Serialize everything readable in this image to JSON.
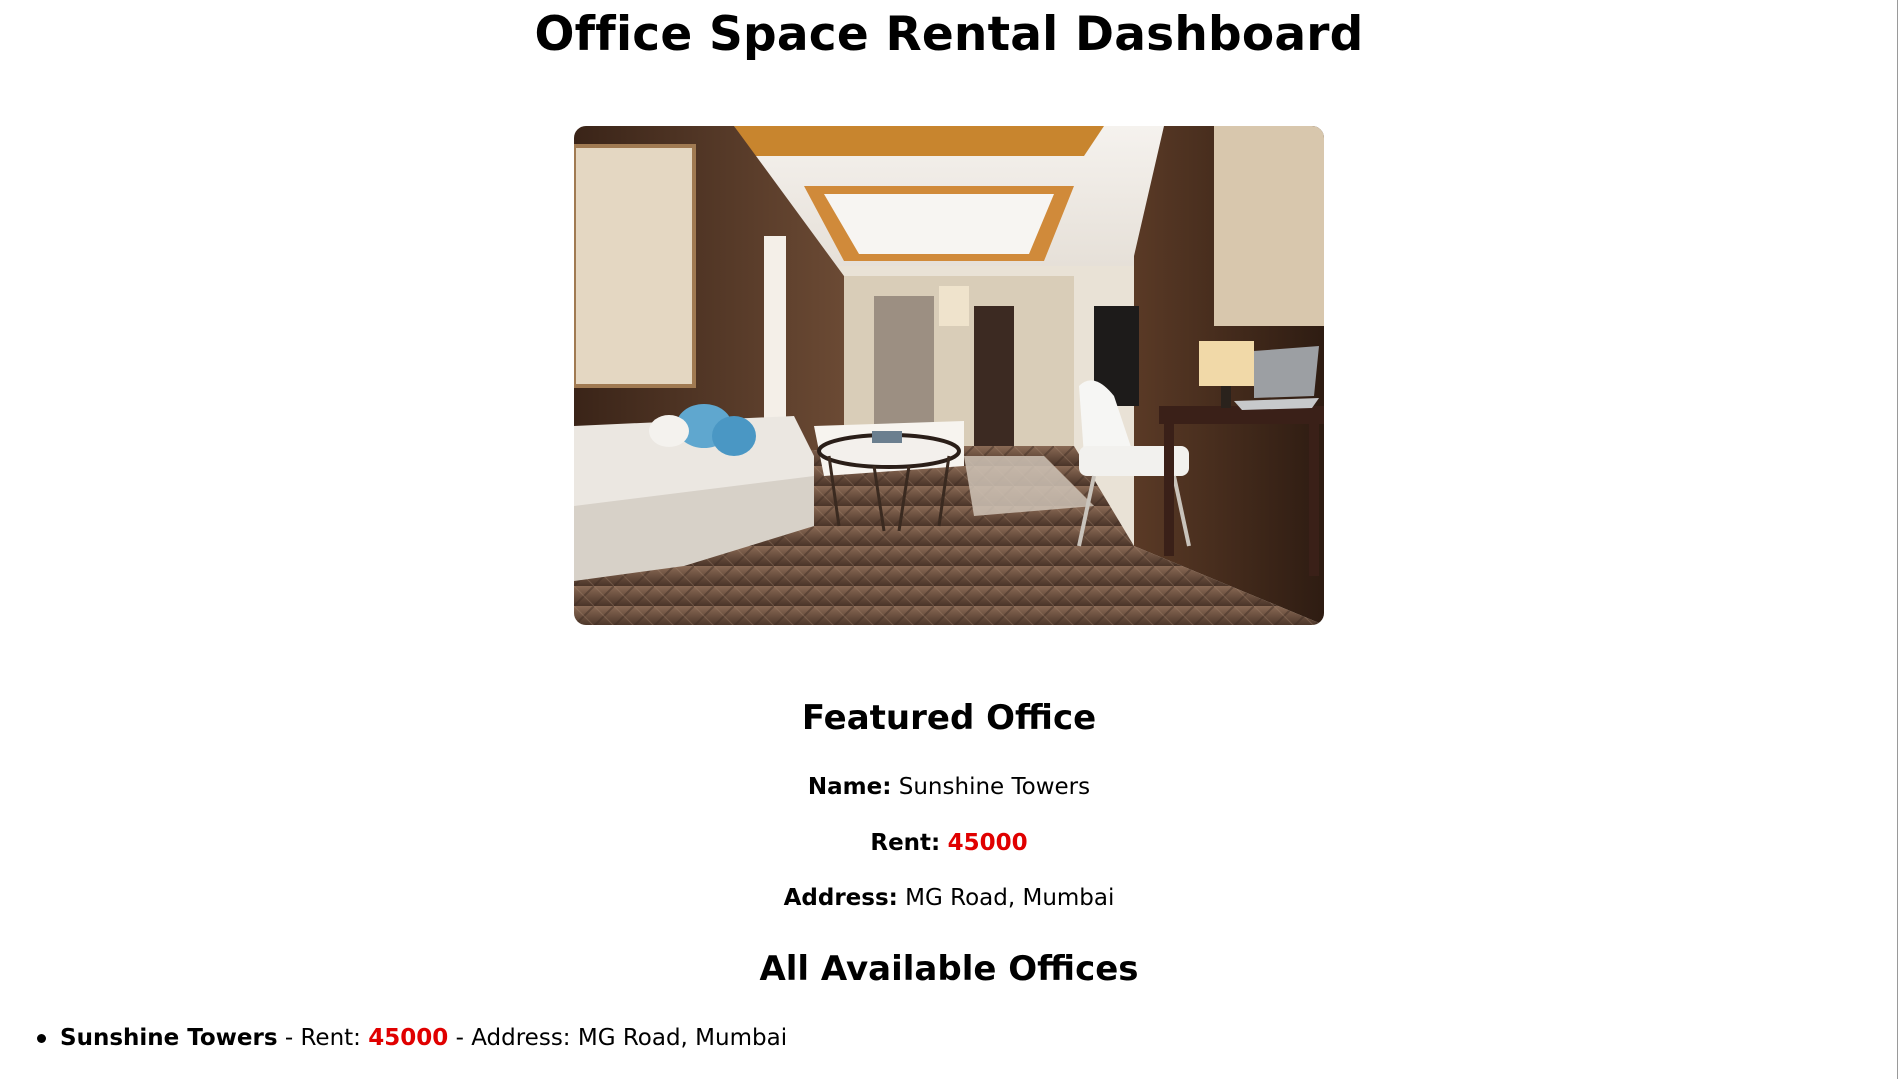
{
  "page": {
    "title": "Office Space Rental Dashboard"
  },
  "hero_image": {
    "icon": "office-interior-photo"
  },
  "featured": {
    "heading": "Featured Office",
    "name_label": "Name:",
    "name": "Sunshine Towers",
    "rent_label": "Rent:",
    "rent": "45000",
    "address_label": "Address:",
    "address": "MG Road, Mumbai"
  },
  "all_offices": {
    "heading": "All Available Offices",
    "items": [
      {
        "name": "Sunshine Towers",
        "rent_prefix": " - Rent: ",
        "rent": "45000",
        "address_prefix": " - Address: ",
        "address": "MG Road, Mumbai"
      }
    ]
  },
  "colors": {
    "rent_highlight": "#e00000",
    "text": "#000000",
    "background": "#ffffff"
  }
}
